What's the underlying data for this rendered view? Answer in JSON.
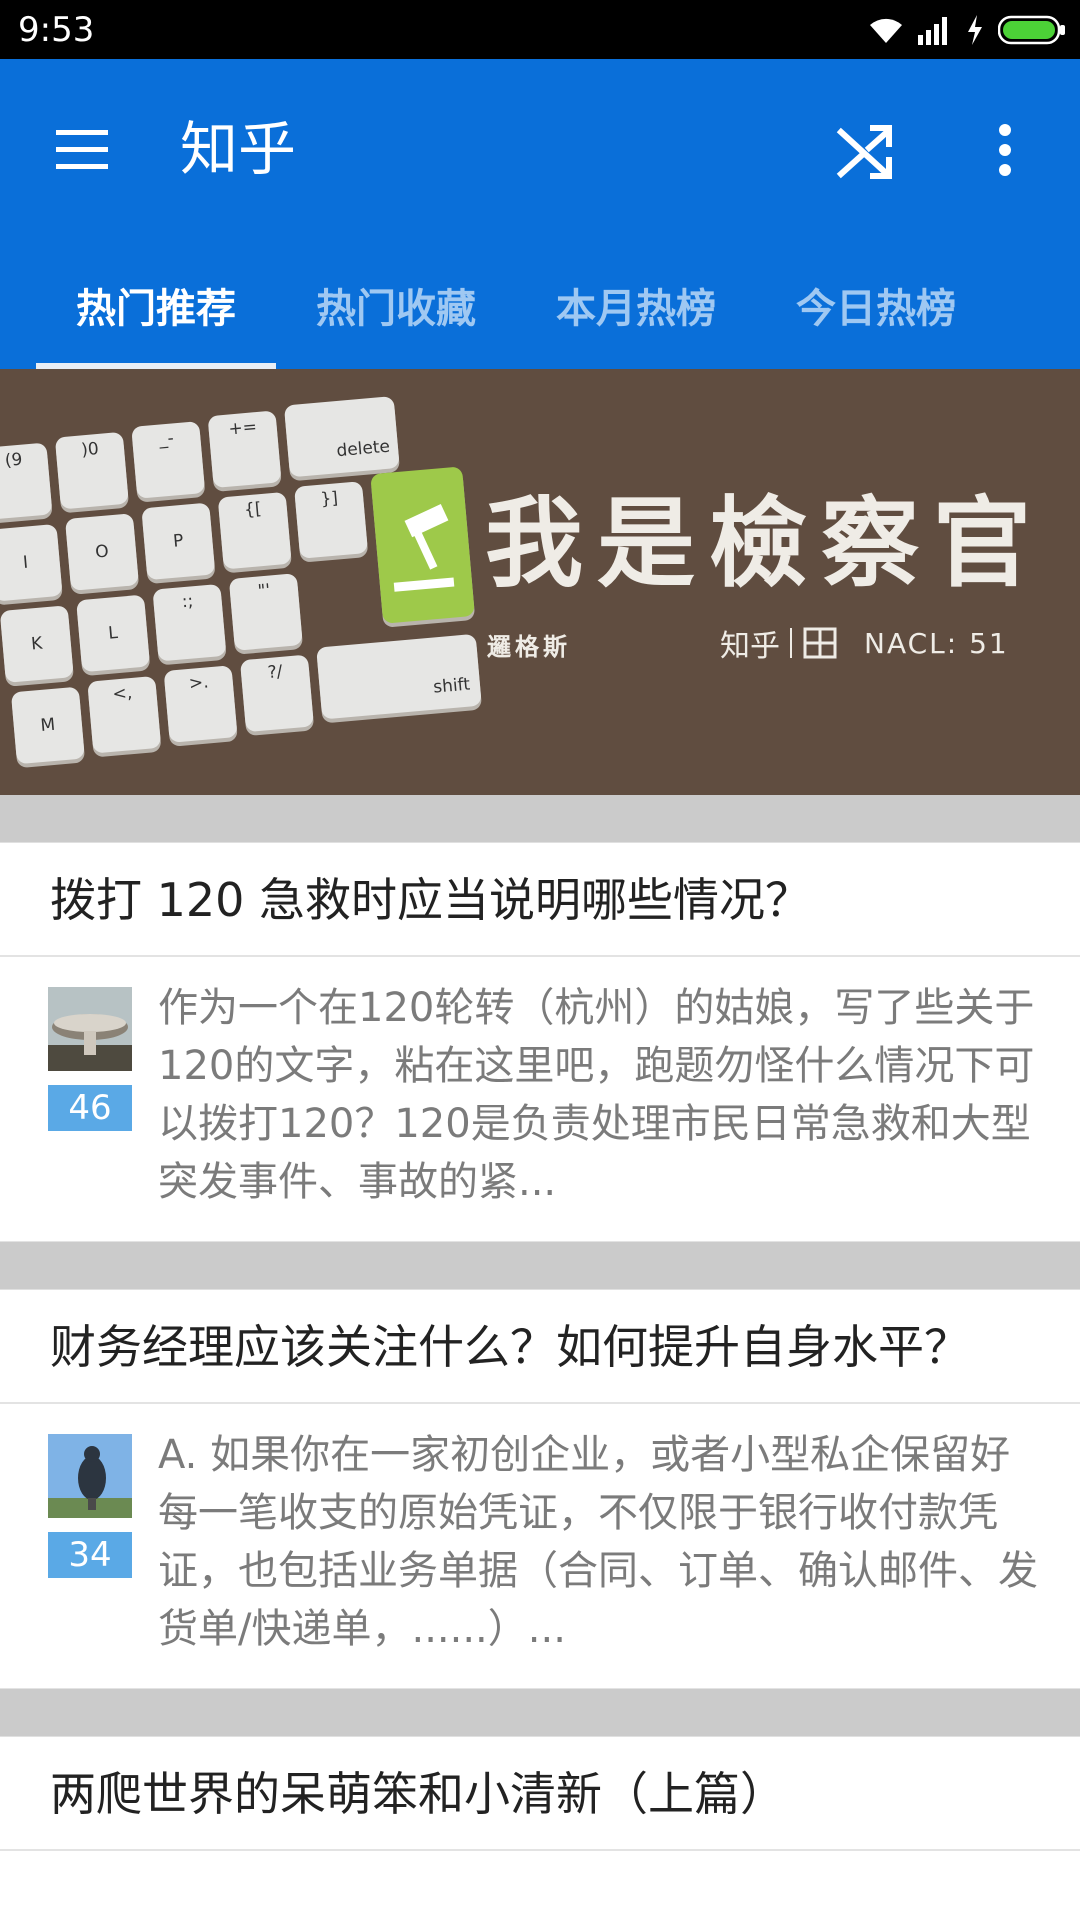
{
  "status_bar": {
    "time": "9:53",
    "icons": [
      "wifi-icon",
      "signal-icon",
      "charging-icon",
      "battery-icon"
    ],
    "battery_color": "#4cd137"
  },
  "app_bar": {
    "title": "知乎",
    "background_color": "#0a6fd9",
    "icons": [
      "menu-icon",
      "shuffle-icon",
      "more-vert-icon"
    ]
  },
  "tabs": [
    {
      "label": "热门推荐",
      "active": true
    },
    {
      "label": "热门收藏",
      "active": false
    },
    {
      "label": "本月热榜",
      "active": false
    },
    {
      "label": "今日热榜",
      "active": false
    }
  ],
  "banner": {
    "title": "我是檢察官",
    "author": "邏格斯",
    "brand": "知乎",
    "nacl": "NACL: 51",
    "background_color": "#604d40",
    "keys": [
      "(9",
      ")0",
      "_-",
      "+=",
      "delete",
      "I",
      "O",
      "P",
      "{[",
      "}]",
      "K",
      "L",
      ":;",
      "\"'",
      "M",
      "<,",
      ">.",
      "?/",
      "shift"
    ]
  },
  "feed": [
    {
      "title": "拨打 120 急救时应当说明哪些情况？",
      "votes": "46",
      "avatar": "mushroom-avatar",
      "excerpt": "作为一个在120轮转（杭州）的姑娘，写了些关于120的文字，粘在这里吧，跑题勿怪什么情况下可以拨打120？120是负责处理市民日常急救和大型突发事件、事故的紧..."
    },
    {
      "title": "财务经理应该关注什么？如何提升自身水平？",
      "votes": "34",
      "avatar": "bird-avatar",
      "excerpt": "A. 如果你在一家初创企业，或者小型私企保留好每一笔收支的原始凭证，不仅限于银行收付款凭证，也包括业务单据（合同、订单、确认邮件、发货单/快递单，......）..."
    },
    {
      "title": "两爬世界的呆萌笨和小清新（上篇）"
    }
  ]
}
